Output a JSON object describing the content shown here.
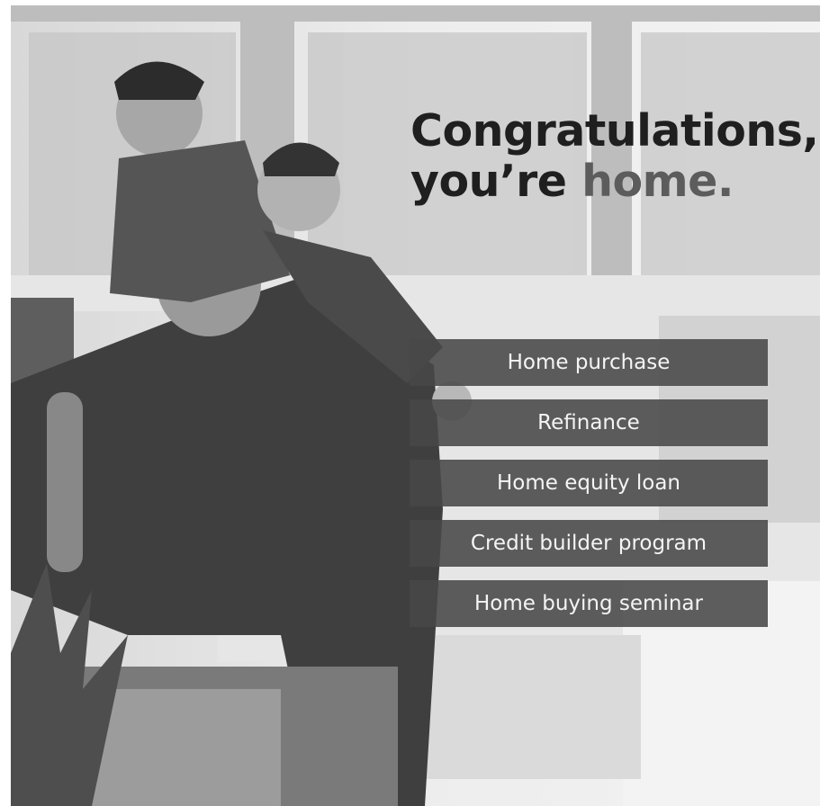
{
  "headline": {
    "line1": "Congratulations,",
    "line2_prefix": "you’re",
    "line2_accent": "home."
  },
  "menu": {
    "items": [
      {
        "label": "Home purchase"
      },
      {
        "label": "Refinance"
      },
      {
        "label": "Home equity loan"
      },
      {
        "label": "Credit builder program"
      },
      {
        "label": "Home buying seminar"
      }
    ]
  },
  "colors": {
    "headline": "#1f1f1f",
    "headline_accent": "#5c5c5c",
    "button_bg": "#484848",
    "button_text": "#f4f4f4"
  }
}
